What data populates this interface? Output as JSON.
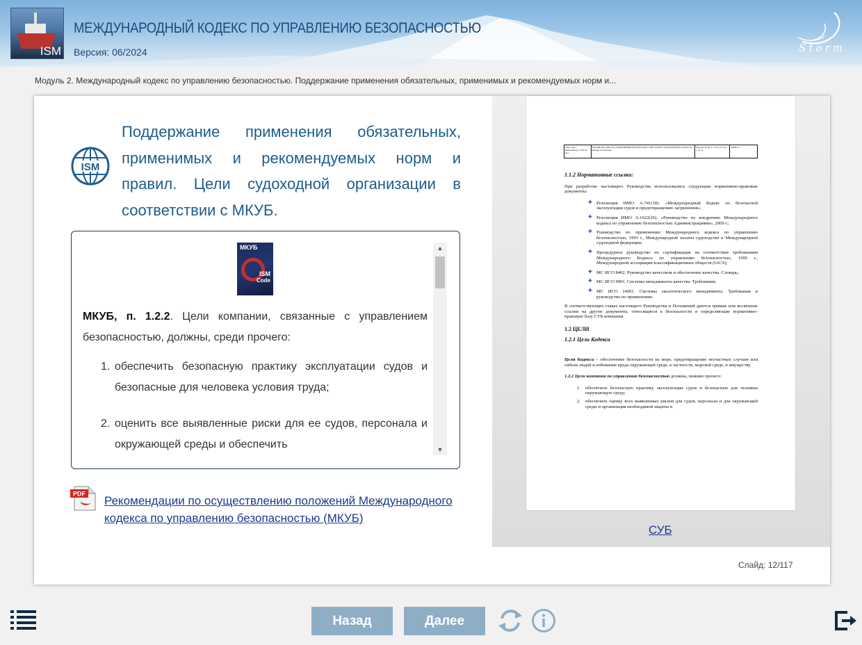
{
  "header": {
    "logo_text": "ISM",
    "title": "МЕЖДУНАРОДНЫЙ КОДЕКС ПО УПРАВЛЕНИЮ БЕЗОПАСНОСТЬЮ",
    "version": "Версия: 06/2024",
    "brand": "Storm"
  },
  "breadcrumb": "Модуль 2. Международный кодекс по управлению безопасностью. Поддержание применения обязательных, применимых и рекомендуемых норм и...",
  "slide": {
    "icon_text": "ISM",
    "title_line1": "Поддержание применения обязательных,",
    "title_line2": "применимых и рекомендуемых норм и",
    "title_line3": "правил. Цели судоходной организации в",
    "title_line4": "соответствии с МКУБ.",
    "book": {
      "title": "МКУБ",
      "line1": "ISM",
      "line2": "Code"
    },
    "ref_bold": "МКУБ, п. 1.2.2",
    "ref_text": ". Цели компании, связанные с управлением безопасностью, должны, среди прочего:",
    "list": [
      {
        "num": "1.",
        "text": "обеспечить безопасную практику эксплуатации судов и безопасные для человека условия труда;"
      },
      {
        "num": "2.",
        "text": "оценить все выявленные риски для ее судов, персонала и окружающей среды и обеспечить"
      }
    ],
    "pdf_badge": "PDF",
    "pdf_link": "Рекомендации по осуществлению положений Международного кодекса по управлению безопасностью (МКУБ)",
    "preview_link": "СУБ",
    "slide_counter": "Слайд: 12/117"
  },
  "doc_preview": {
    "hdr1": "ООО Лара-Менеджмент СУБ 01-Лот",
    "hdr2": "РУКОВОДСТВО ПО УПРАВЛЕНИЮ БЕЗОПАСНОСТЬЮ SAFETY MANAGEMENT MANUAL Общие положения",
    "hdr3": "Версия: В Дата: 11.01.14 Стр.: 7 из 11",
    "hdr4": "SMM-01",
    "h1": "1.1.2 Нормативные ссылки:",
    "p1": "При разработке настоящего Руководства использовались следующие нормативно-правовые документы:",
    "b1": "Резолюция ИМО А.741(18). «Международный Кодекс по безопасной эксплуатации судов и предотвращению загрязнения»;",
    "b2": "Резолюция ИМО А.1022(26). «Руководство по внедрению Международного кодекса по управлению безопасностью Администрациями», 2009 г.;",
    "b3": "Руководство по применению Международного кодекса по управлению безопасностью, 1993 г., Международной палаты судоходства и Международной судоходной федерации;",
    "b4": "Процедурное руководство по сертификации на соответствие требованиям Международного Кодекса по управлению безопасностью, 1995 г., Международной ассоциации классификационных обществ (IACS);",
    "b5": "МС ИСО 8402. Руководство качеством и обеспечение качества. Словарь;",
    "b6": "МС ИСО 9001. Системы менеджмента качества. Требования;",
    "b7": "МС ИСО 14001. Системы экологического менеджмента. Требования и руководство по применению.",
    "p2": "В соответствующих главах настоящего Руководства и Положений даются прямые или косвенные ссылки на другие документы, относящиеся к безопасности и определяющие нормативно-правовую базу СУБ компании.",
    "h2": "1.2 ЦЕЛИ",
    "h3": "1.2.1 Цели Кодекса",
    "p3_bold": "Цели Кодекса",
    "p3": " – обеспечение безопасности на море, предотвращение несчастных случаев или гибели людей и избежание вреда окружающей среде, в частности, морской среде, и имуществу.",
    "h4": "1.2.2 Цели компании по управлению безопасностью",
    "h4_tail": " должны, помимо прочего:",
    "n1": "обеспечить безопасную практику эксплуатации судов и безопасную для человека окружающую среду;",
    "n2": "обеспечить оценку всех выявленных рисков для судов, персонала и для окружающей среды и организация необходимой защиты и"
  },
  "nav": {
    "back": "Назад",
    "next": "Далее"
  },
  "colors": {
    "title_blue": "#1d5d8c",
    "header_text": "#1d4a78",
    "button_bg": "#8eaec6",
    "link_blue": "#1c3a8c"
  }
}
